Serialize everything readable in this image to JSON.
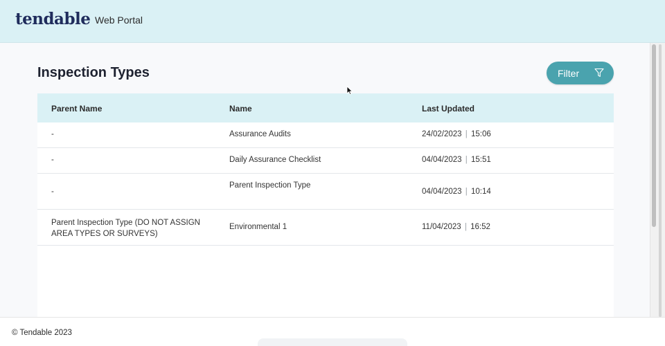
{
  "header": {
    "logo": "tendable",
    "portal_title": "Web Portal"
  },
  "page": {
    "title": "Inspection Types",
    "filter_label": "Filter"
  },
  "table": {
    "columns": [
      "Parent Name",
      "Name",
      "Last Updated"
    ],
    "rows": [
      {
        "parent": "-",
        "name": "Assurance Audits",
        "date": "24/02/2023",
        "time": "15:06"
      },
      {
        "parent": "-",
        "name": "Daily Assurance Checklist",
        "date": "04/04/2023",
        "time": "15:51"
      },
      {
        "parent": "-",
        "name": "Parent Inspection Type",
        "date": "04/04/2023",
        "time": "10:14"
      },
      {
        "parent": "Parent Inspection Type (DO NOT ASSIGN AREA TYPES OR SURVEYS)",
        "name": "Environmental 1",
        "date": "11/04/2023",
        "time": "16:52"
      }
    ],
    "separator": "|"
  },
  "footer": {
    "copyright": "© Tendable 2023"
  },
  "colors": {
    "header_bg": "#daf1f5",
    "accent": "#4aa3ae",
    "logo": "#1f2c5c"
  },
  "icons": {
    "filter": "filter-funnel-icon",
    "cursor": "mouse-pointer-icon"
  }
}
